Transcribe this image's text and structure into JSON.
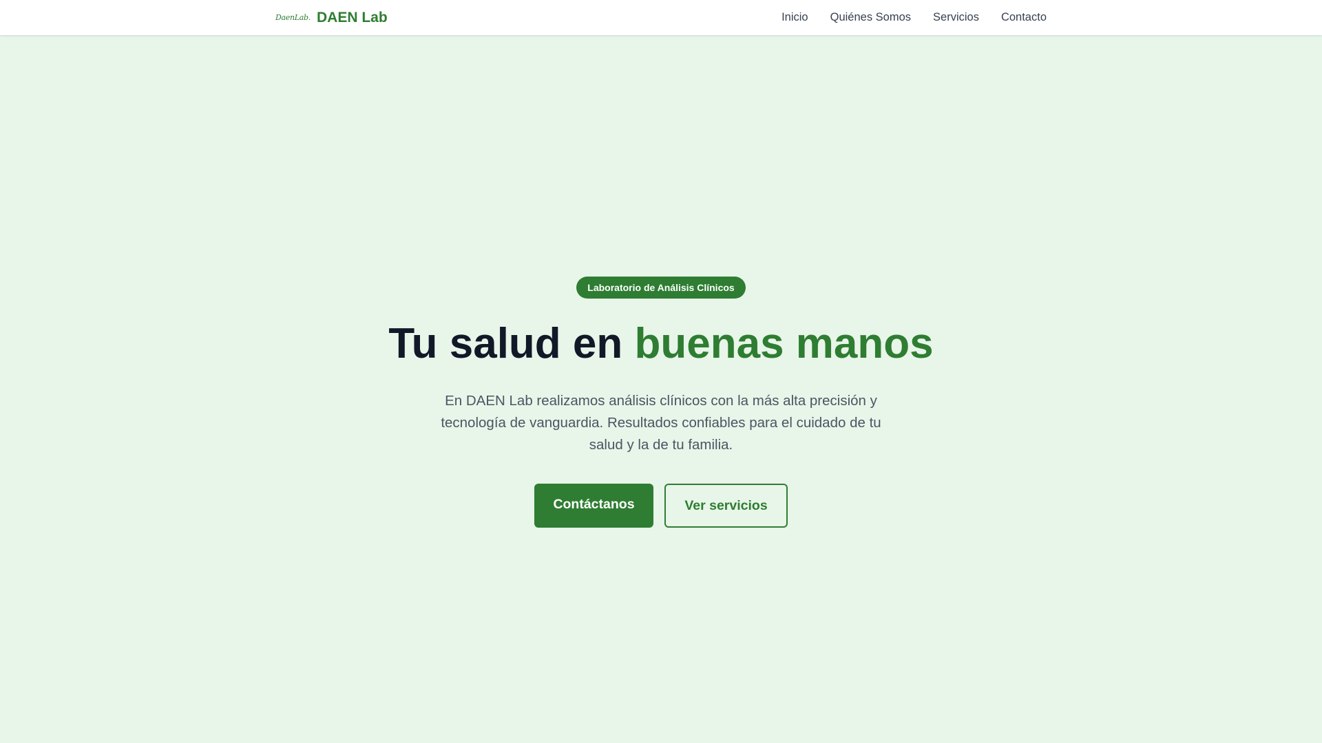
{
  "header": {
    "logo_text": "DaenLab.",
    "brand": "DAEN Lab",
    "nav": [
      {
        "label": "Inicio"
      },
      {
        "label": "Quiénes Somos"
      },
      {
        "label": "Servicios"
      },
      {
        "label": "Contacto"
      }
    ]
  },
  "hero": {
    "badge": "Laboratorio de Análisis Clínicos",
    "title_main": "Tu salud en ",
    "title_accent": "buenas manos",
    "description": "En DAEN Lab realizamos análisis clínicos con la más alta precisión y tecnología de vanguardia. Resultados confiables para el cuidado de tu salud y la de tu familia.",
    "primary_button": "Contáctanos",
    "secondary_button": "Ver servicios"
  },
  "colors": {
    "accent": "#2e7d32",
    "background": "#e8f5e9",
    "heading": "#111827"
  }
}
